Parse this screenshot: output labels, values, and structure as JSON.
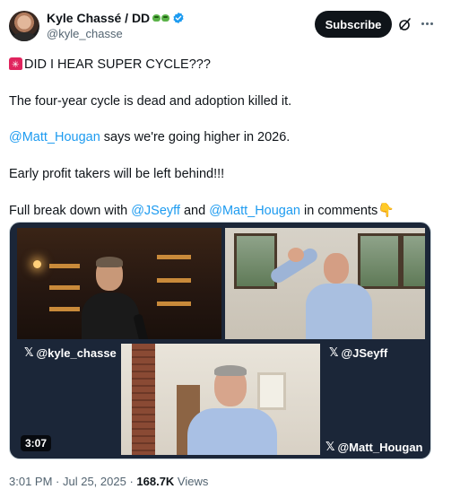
{
  "author": {
    "display_name": "Kyle Chassé / DD",
    "handle": "@kyle_chasse",
    "verified": true,
    "name_emoji": "frog-icon"
  },
  "header": {
    "subscribe_label": "Subscribe",
    "grok_icon": "grok-icon",
    "more_icon": "more-options-icon"
  },
  "tweet": {
    "line1": "DID I HEAR SUPER CYCLE???",
    "line2": "The four-year cycle is dead and adoption killed it.",
    "line3_mention": "@Matt_Hougan",
    "line3_rest": " says we're going higher in 2026.",
    "line4": "Early profit takers will be left behind!!!",
    "line5_prefix": "Full break down with ",
    "line5_mention1": "@JSeyff",
    "line5_mid": " and ",
    "line5_mention2": "@Matt_Hougan",
    "line5_suffix": " in comments"
  },
  "media": {
    "labels": [
      "@kyle_chasse",
      "@JSeyff",
      "@Matt_Hougan"
    ],
    "duration": "3:07"
  },
  "footer": {
    "time": "3:01 PM",
    "separator": " · ",
    "date": "Jul 25, 2025",
    "views_count": "168.7K",
    "views_label": " Views"
  },
  "colors": {
    "link": "#1d9bf0",
    "text": "#0f1419",
    "muted": "#536471",
    "subscribe_bg": "#0f1419",
    "verified": "#1d9bf0"
  }
}
